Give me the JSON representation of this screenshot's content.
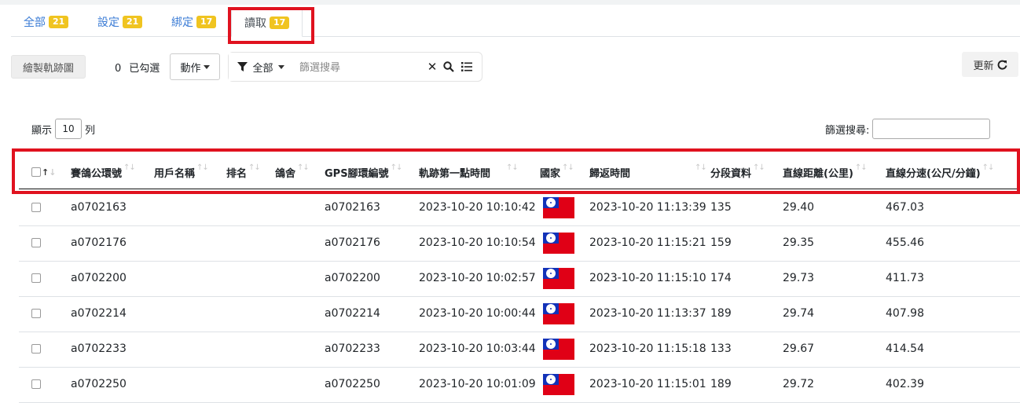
{
  "tabs": [
    {
      "label": "全部",
      "count": "21"
    },
    {
      "label": "設定",
      "count": "21"
    },
    {
      "label": "綁定",
      "count": "17"
    },
    {
      "label": "讀取",
      "count": "17"
    }
  ],
  "active_tab": "讀取",
  "toolbar": {
    "draw_track_label": "繪製軌跡圖",
    "selected_count": "0",
    "selected_label": "已勾選",
    "action_label": "動作",
    "filter_label": "全部",
    "search_placeholder": "篩選搜尋",
    "refresh_label": "更新"
  },
  "table_controls": {
    "show_label": "顯示",
    "page_length": "10",
    "rows_label": "列",
    "filter_search_label": "篩選搜尋:"
  },
  "columns": [
    "賽鴿公環號",
    "用戶名稱",
    "排名",
    "鴿舍",
    "GPS腳環編號",
    "軌跡第一點時間",
    "國家",
    "歸返時間",
    "分段資料",
    "直線距離(公里)",
    "直線分速(公尺/分鐘)"
  ],
  "rows": [
    {
      "ring": "a0702163",
      "user": "",
      "rank": "",
      "loft": "",
      "gps": "a0702163",
      "first_point": "2023-10-20 10:10:42",
      "country": "taiwan-flag",
      "return_time": "2023-10-20 11:13:39",
      "segments": "135",
      "distance": "29.40",
      "speed": "467.03"
    },
    {
      "ring": "a0702176",
      "user": "",
      "rank": "",
      "loft": "",
      "gps": "a0702176",
      "first_point": "2023-10-20 10:10:54",
      "country": "taiwan-flag",
      "return_time": "2023-10-20 11:15:21",
      "segments": "159",
      "distance": "29.35",
      "speed": "455.46"
    },
    {
      "ring": "a0702200",
      "user": "",
      "rank": "",
      "loft": "",
      "gps": "a0702200",
      "first_point": "2023-10-20 10:02:57",
      "country": "taiwan-flag",
      "return_time": "2023-10-20 11:15:10",
      "segments": "174",
      "distance": "29.73",
      "speed": "411.73"
    },
    {
      "ring": "a0702214",
      "user": "",
      "rank": "",
      "loft": "",
      "gps": "a0702214",
      "first_point": "2023-10-20 10:00:44",
      "country": "taiwan-flag",
      "return_time": "2023-10-20 11:13:37",
      "segments": "189",
      "distance": "29.74",
      "speed": "407.98"
    },
    {
      "ring": "a0702233",
      "user": "",
      "rank": "",
      "loft": "",
      "gps": "a0702233",
      "first_point": "2023-10-20 10:03:44",
      "country": "taiwan-flag",
      "return_time": "2023-10-20 11:15:18",
      "segments": "133",
      "distance": "29.67",
      "speed": "414.54"
    },
    {
      "ring": "a0702250",
      "user": "",
      "rank": "",
      "loft": "",
      "gps": "a0702250",
      "first_point": "2023-10-20 10:01:09",
      "country": "taiwan-flag",
      "return_time": "2023-10-20 11:15:01",
      "segments": "189",
      "distance": "29.72",
      "speed": "402.39"
    }
  ],
  "colors": {
    "accent": "#3a7bd5",
    "badge": "#f0c420",
    "highlight": "#e0121f"
  }
}
